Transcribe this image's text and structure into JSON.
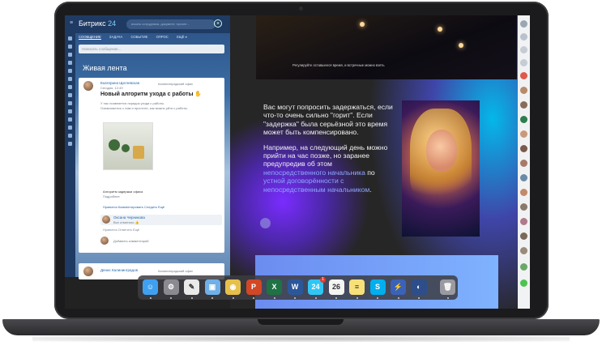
{
  "bitrix": {
    "logo_text": "Битрикс",
    "logo_num": "24",
    "search_placeholder": "искать сотрудника, документ, прочее...",
    "tabs": [
      {
        "label": "СООБЩЕНИЕ"
      },
      {
        "label": "ЗАДАЧА"
      },
      {
        "label": "СОБЫТИЕ"
      },
      {
        "label": "ОПРОС"
      },
      {
        "label": "ЕЩЁ ▾"
      }
    ],
    "post_placeholder": "Написать сообщение...",
    "feed_title": "Живая лента",
    "post": {
      "author": "Екатерина Щеглевская",
      "recipient": "Калининградский офис",
      "date": "Сегодня, 12:49",
      "title": "Новый алгоритм ухода с работы",
      "line1": "У нас появляется порядок ухода с работы.",
      "line2": "Ознакомьтесь с ним и прочтите, как можно уйти с работы.",
      "image_caption": "Алгоритм задержки офиса",
      "image_sub": "Подробнее",
      "actions": "Нравится   Комментировать   Следить   Ещё",
      "comment_author": "Оксана Черникова",
      "comment_text": "Все отметили 👍",
      "comment_actions": "Нравится   Ответить   Ещё",
      "comment_placeholder": "Добавить комментарий"
    },
    "post2": {
      "author": "Денис Калининградов",
      "recipient": "Калининградский офис"
    }
  },
  "presentation": {
    "night_caption": "Регулируйте оставшееся время, и встречные можно взять",
    "paragraph1": "Вас могут попросить задержаться, если что-то очень сильно \"горит\". Если \"задержка\" была серьёзной это время может быть компенсировано.",
    "paragraph2_a": "Например, на следующий день можно прийти на час позже, но заранее предупредив об этом ",
    "paragraph2_hl1": "непосредственного начальника",
    "paragraph2_b": " по ",
    "paragraph2_hl2": "устной договорённости с непосредственным начальником",
    "paragraph2_c": "."
  },
  "dock": {
    "items": [
      {
        "name": "finder-icon",
        "glyph": "☺",
        "color": "#3fa0f0"
      },
      {
        "name": "system-preferences-icon",
        "glyph": "⚙",
        "color": "#8a8a90"
      },
      {
        "name": "textedit-icon",
        "glyph": "✎",
        "color": "#e9e9e9"
      },
      {
        "name": "preview-icon",
        "glyph": "▣",
        "color": "#6fb0e8"
      },
      {
        "name": "chrome-icon",
        "glyph": "◉",
        "color": "#e6c04a"
      },
      {
        "name": "powerpoint-icon",
        "glyph": "P",
        "color": "#d24726"
      },
      {
        "name": "excel-icon",
        "glyph": "X",
        "color": "#1f7244"
      },
      {
        "name": "word-icon",
        "glyph": "W",
        "color": "#2b579a"
      },
      {
        "name": "bitrix24-icon",
        "glyph": "24",
        "color": "#2fc6f6",
        "badge": "1"
      },
      {
        "name": "calendar-icon",
        "glyph": "26",
        "color": "#f4f4f4"
      },
      {
        "name": "notes-icon",
        "glyph": "≡",
        "color": "#f7e07a"
      },
      {
        "name": "skype-icon",
        "glyph": "S",
        "color": "#00aff0"
      },
      {
        "name": "winamp-icon",
        "glyph": "⚡",
        "color": "#3a62b8"
      },
      {
        "name": "camino-icon",
        "glyph": "◐",
        "color": "#2d4e8a"
      },
      {
        "name": "trash-icon",
        "glyph": "🗑",
        "color": "#9a9aa0"
      }
    ]
  },
  "colors": {
    "accent": "#2fc6f6",
    "presentation_bg": "#262626",
    "highlight_text": "#8fa7ff"
  }
}
